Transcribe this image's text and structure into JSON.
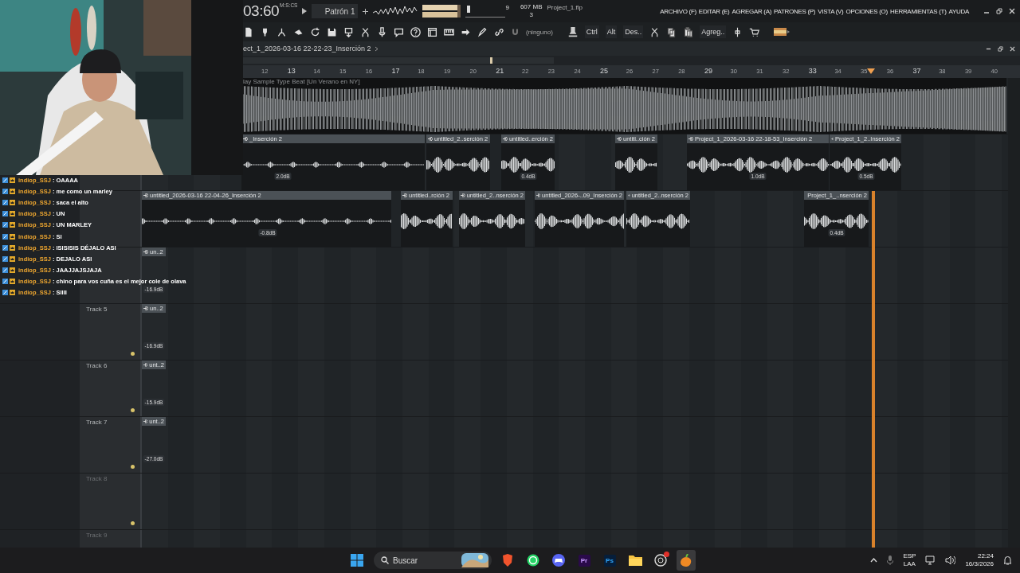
{
  "header": {
    "time": "03:60",
    "time_unit": "M:S:CS",
    "pattern": "Patrón 1",
    "pitch": {
      "level": 0.04
    },
    "cpu": "9",
    "memory": "607 MB",
    "polyphony": "3",
    "project_file": "Project_1.flp",
    "menu": [
      "ARCHIVO (F)",
      "EDITAR (E)",
      "AGREGAR (A)",
      "PATRONES (P)",
      "VISTA (V)",
      "OPCIONES (O)",
      "HERRAMIENTAS (T)",
      "AYUDA"
    ]
  },
  "toolbar": {
    "snap": "(ninguno)",
    "buttons": [
      "Ctrl",
      "Alt",
      "Des..",
      "Agreg.."
    ]
  },
  "playlist": {
    "breadcrumb": "ect_1_2026-03-16 22-22-23_Inserción 2",
    "ruler": [
      "12",
      "13",
      "14",
      "15",
      "16",
      "17",
      "18",
      "19",
      "20",
      "21",
      "22",
      "23",
      "24",
      "25",
      "26",
      "27",
      "28",
      "29",
      "30",
      "31",
      "32",
      "33",
      "34",
      "35",
      "36",
      "37",
      "38",
      "39",
      "40"
    ],
    "tracks": [
      {
        "clips": [
          {
            "label": "lay Sample Type Beat [Un Verano en NY]"
          }
        ]
      },
      {
        "clips": [
          {
            "label": "_Inserción 2",
            "volume": "2.0dB"
          },
          {
            "label": "untitled_2..serción 2"
          },
          {
            "label": "untitled..erción 2",
            "volume": "0.4dB"
          },
          {
            "label": "untitl..ción 2"
          },
          {
            "label": "Project_1_2026-03-16 22-18-53_Inserción 2",
            "volume": "1.0dB"
          },
          {
            "label": "Project_1_2..Inserción 2",
            "volume": "0.5dB"
          }
        ]
      },
      {
        "clips": [
          {
            "label": "untitled_2026-03-16 22-04-26_Inserción 2",
            "volume": "-0.8dB"
          },
          {
            "label": "untitled..rción 2"
          },
          {
            "label": "untitled_2..nserción 2"
          },
          {
            "label": "untitled_2026-..09_Inserción 2"
          },
          {
            "label": "untitled_2..nserción 2"
          },
          {
            "label": "Project_1_..nserción 2",
            "volume": "0.4dB"
          }
        ]
      },
      {
        "clips": [
          {
            "label": "un..2",
            "volume": "-16.9dB"
          }
        ]
      },
      {
        "name": "Track 5",
        "clips": [
          {
            "label": "un..2",
            "volume": "-16.9dB"
          }
        ]
      },
      {
        "name": "Track 6",
        "clips": [
          {
            "label": "unt..2",
            "volume": "-15.9dB"
          }
        ]
      },
      {
        "name": "Track 7",
        "clips": [
          {
            "label": "unt..2",
            "volume": "-27.0dB"
          }
        ]
      },
      {
        "name": "Track 8"
      },
      {
        "name": "Track 9"
      }
    ]
  },
  "chat": [
    {
      "user": "indiop_SSJ",
      "message": ": OAAAA"
    },
    {
      "user": "indiop_SSJ",
      "message": ": me como un marley"
    },
    {
      "user": "indiop_SSJ",
      "message": ": saca el alto"
    },
    {
      "user": "indiop_SSJ",
      "message": ": UN"
    },
    {
      "user": "indiop_SSJ",
      "message": ": UN MARLEY"
    },
    {
      "user": "indiop_SSJ",
      "message": ": SI"
    },
    {
      "user": "indiop_SSJ",
      "message": ": ISISISIS DÉJALO ASI"
    },
    {
      "user": "indiop_SSJ",
      "message": ": DEJALO ASI"
    },
    {
      "user": "indiop_SSJ",
      "message": ": JAAJJAJSJAJA"
    },
    {
      "user": "indiop_SSJ",
      "message": ": chino para vos cuña es el mejor cole de olava"
    },
    {
      "user": "indiop_SSJ",
      "message": ": SIIII"
    }
  ],
  "taskbar": {
    "search": {
      "placeholder": "Buscar"
    },
    "apps": [
      {
        "kind": "shield",
        "selected": false,
        "badge": false
      },
      {
        "kind": "phone",
        "selected": false,
        "badge": false
      },
      {
        "kind": "controller",
        "selected": false,
        "badge": false
      },
      {
        "kind": "tile",
        "label": "Pr",
        "selected": false,
        "badge": false
      },
      {
        "kind": "tile",
        "label": "Ps",
        "selected": false,
        "badge": false
      },
      {
        "kind": "folder",
        "selected": false,
        "badge": false
      },
      {
        "kind": "ring",
        "selected": false,
        "badge": true
      },
      {
        "kind": "fruit",
        "selected": true,
        "badge": false
      }
    ],
    "tray": {
      "language": "ESP",
      "layout": "LAA",
      "time": "22:24",
      "date": "16/3/2026"
    }
  }
}
